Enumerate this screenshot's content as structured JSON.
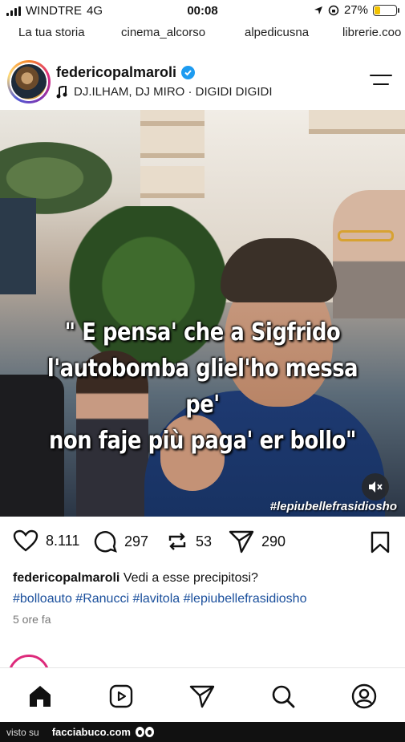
{
  "status_bar": {
    "carrier": "WINDTRE",
    "network": "4G",
    "time": "00:08",
    "battery": "27%",
    "battery_level": 0.27
  },
  "stories": [
    "La tua storia",
    "cinema_alcorso",
    "alpedicusna",
    "librerie.coo"
  ],
  "post": {
    "username": "federicopalmaroli",
    "verified": true,
    "music": "DJ.ILHAM, DJ MIRO · DIGIDI DIGIDI",
    "image_caption_lines": [
      "\" E pensa' che a Sigfrido",
      "l'autobomba gliel'ho messa pe'",
      "non faje più paga' er bollo\""
    ],
    "image_hashtag": "#lepiubellefrasidiosho",
    "likes": "8.111",
    "comments": "297",
    "reposts": "53",
    "shares": "290",
    "caption_user": "federicopalmaroli",
    "caption_text": "Vedi a esse precipitosi?",
    "hashtags": "#bolloauto #Ranucci #lavitola #lepiubellefrasidiosho",
    "time_ago": "5 ore fa"
  },
  "footer": {
    "seen_on": "visto su",
    "site": "facciabuco.com"
  },
  "colors": {
    "verified": "#1d9bf0",
    "hashtag": "#1a4f9c",
    "battery": "#f2c200"
  }
}
